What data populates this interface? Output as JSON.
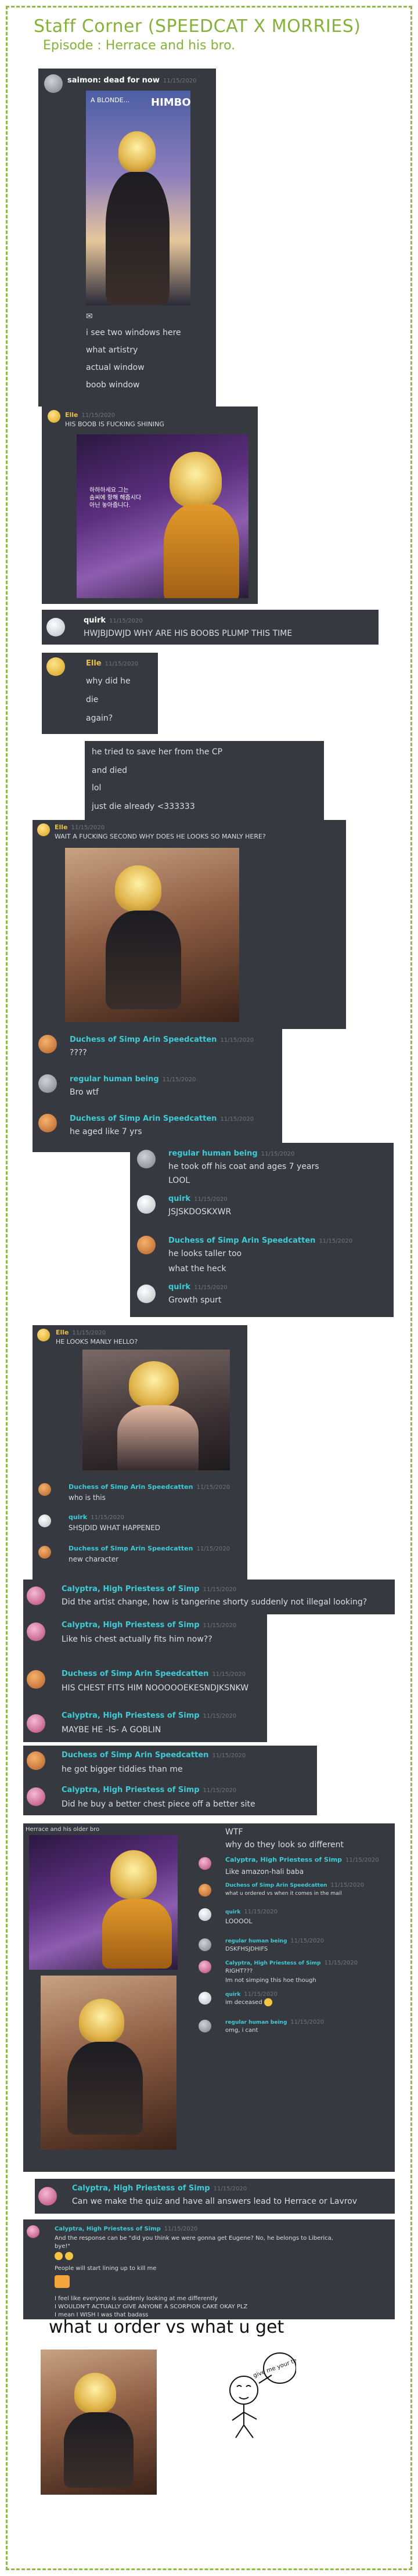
{
  "header": {
    "title": "Staff Corner (SPEEDCAT X MORRIES)",
    "subtitle": "Episode : Herrace and his bro."
  },
  "posts": {
    "saimon": {
      "name": "saimon: dead for now",
      "time": "11/15/2020",
      "poster_a": "A BLONDE...",
      "poster_b": "HIMBO",
      "lines": [
        "i see two windows here",
        "what artistry",
        "actual window",
        "boob window"
      ]
    },
    "elle1": {
      "name": "Elle",
      "time": "11/15/2020",
      "text": "HIS BOOB IS FUCKING SHINING",
      "panel_text": "하하하세요 그는\n솜씨에 항해 해줍시다\n아닌 놓아줍니다."
    },
    "quirk1": {
      "name": "quirk",
      "time": "11/15/2020",
      "text": "HWJBJDWJD WHY ARE HIS BOOBS PLUMP THIS TIME"
    },
    "elle2": {
      "name": "Elle",
      "time": "11/15/2020",
      "lines": [
        "why did he",
        "die",
        "again?"
      ]
    },
    "died": {
      "lines": [
        "he tried to save her from the CP",
        "and died",
        "lol",
        "just die already <333333"
      ]
    },
    "elle3": {
      "name": "Elle",
      "time": "11/15/2020",
      "text": "WAIT A FUCKING SECOND WHY DOES HE LOOKS SO MANLY HERE?"
    },
    "duch1": {
      "name": "Duchess of Simp Arin Speedcatten",
      "time": "11/15/2020",
      "text": "????"
    },
    "regular1": {
      "name": "regular human being",
      "time": "11/15/2020",
      "text": "Bro wtf"
    },
    "duch2": {
      "name": "Duchess of Simp Arin Speedcatten",
      "time": "11/15/2020",
      "text": "he aged like 7 yrs"
    },
    "regular2": {
      "name": "regular human being",
      "time": "11/15/2020",
      "lines": [
        "he took off his coat and ages 7 years",
        "LOOL"
      ]
    },
    "quirk2": {
      "name": "quirk",
      "time": "11/15/2020",
      "text": "JSJSKDOSKXWR"
    },
    "duch3": {
      "name": "Duchess of Simp Arin Speedcatten",
      "time": "11/15/2020",
      "lines": [
        "he looks taller too",
        "what the heck"
      ]
    },
    "quirk3": {
      "name": "quirk",
      "time": "11/15/2020",
      "text": "Growth spurt"
    },
    "elle4": {
      "name": "Elle",
      "time": "11/15/2020",
      "text": "HE LOOKS MANLY HELLO?"
    },
    "duch4": {
      "name": "Duchess of Simp Arin Speedcatten",
      "time": "11/15/2020",
      "text": "who is this"
    },
    "quirk4": {
      "name": "quirk",
      "time": "11/15/2020",
      "text": "SHSJDID WHAT HAPPENED"
    },
    "duch5": {
      "name": "Duchess of Simp Arin Speedcatten",
      "time": "11/15/2020",
      "text": "new character"
    },
    "caly1": {
      "name": "Calyptra, High Priestess of Simp",
      "time": "11/15/2020",
      "text": "Did the artist change, how is tangerine shorty suddenly not illegal looking?"
    },
    "caly2": {
      "name": "Calyptra, High Priestess of Simp",
      "time": "11/15/2020",
      "text": "Like his chest actually fits him now??"
    },
    "duch6": {
      "name": "Duchess of Simp Arin Speedcatten",
      "time": "11/15/2020",
      "text": "HIS CHEST FITS HIM NOOOOOEKESNDJKSNKW"
    },
    "caly3": {
      "name": "Calyptra, High Priestess of Simp",
      "time": "11/15/2020",
      "text": "MAYBE HE -IS- A GOBLIN"
    },
    "duch7": {
      "name": "Duchess of Simp Arin Speedcatten",
      "time": "11/15/2020",
      "text": "he got bigger tiddies than me"
    },
    "caly4": {
      "name": "Calyptra, High Priestess of Simp",
      "time": "11/15/2020",
      "text": "Did he buy a better chest piece off a better site"
    },
    "herrace": {
      "label": "Herrace and his older bro",
      "lines": [
        "WTF",
        "why do they look so different"
      ]
    },
    "caly5": {
      "name": "Calyptra, High Priestess of Simp",
      "time": "11/15/2020",
      "text": "Like amazon-hali baba"
    },
    "duch8": {
      "name": "Duchess of Simp Arin Speedcatten",
      "time": "11/15/2020",
      "text": "what u ordered vs when it comes in the mail"
    },
    "quirk5": {
      "name": "quirk",
      "time": "11/15/2020",
      "text": "LOOOOL"
    },
    "regular3": {
      "name": "regular human being",
      "time": "11/15/2020",
      "text": "DSKFHSJDHIFS"
    },
    "caly6": {
      "name": "Calyptra, High Priestess of Simp",
      "time": "11/15/2020",
      "lines": [
        "RIGHT???",
        "Im not simping this hoe though"
      ]
    },
    "quirk6": {
      "name": "quirk",
      "time": "11/15/2020",
      "text": "im deceased"
    },
    "regular4": {
      "name": "regular human being",
      "time": "11/15/2020",
      "text": "omg, i cant"
    },
    "caly7": {
      "name": "Calyptra, High Priestess of Simp",
      "time": "11/15/2020",
      "text": "Can we make the quiz and have all answers lead to Herrace or Lavrov"
    },
    "caly8": {
      "name": "Calyptra, High Priestess of Simp",
      "time": "11/15/2020",
      "lines": [
        "And the response can be \"did you think we were gonna get Eugene? No, he belongs to Liberica,",
        "bye!\"",
        "People will start lining up to kill me",
        "I feel like everyone is suddenly looking at me differently",
        "I WOULDN'T ACTUALLY GIVE ANYONE A SCORPION CAKE OKAY PLZ",
        "I mean I WISH I was that badass"
      ]
    }
  },
  "footer": {
    "caption": "what u order vs what u get",
    "sketch_speech": "give me your tears"
  },
  "colors": {
    "border": "#8fb94a",
    "title": "#86b23a",
    "discord_bg": "#36393f",
    "cyan": "#3ecbd5",
    "pink": "#f1a9c6",
    "yellow": "#e7c24a"
  }
}
